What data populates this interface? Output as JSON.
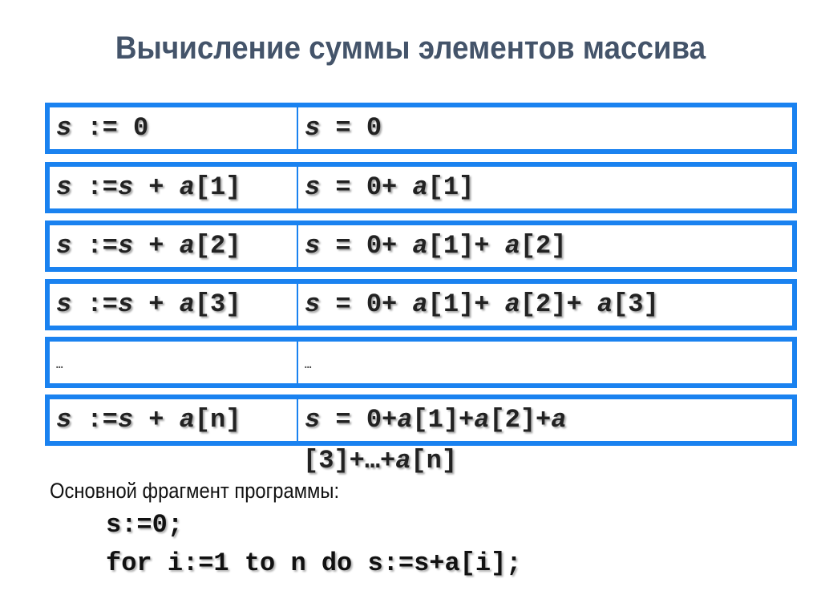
{
  "title": "Вычисление суммы элементов массива",
  "rows": [
    {
      "left": "s := 0",
      "right": "s = 0"
    },
    {
      "left": "s :=s + a[1]",
      "right": "s = 0+ a[1]"
    },
    {
      "left": "s :=s + a[2]",
      "right": "s = 0+ a[1]+ a[2]"
    },
    {
      "left": "s :=s + a[3]",
      "right": "s = 0+ a[1]+ a[2]+ a[3]"
    },
    {
      "left": "…",
      "right": "…"
    },
    {
      "left": "s :=s + a[n]",
      "right": "s = 0+a[1]+a[2]+a"
    }
  ],
  "last_row_continuation": "[3]+…+a[n]",
  "caption": "Основной фрагмент программы:",
  "code": [
    "s:=0;",
    "for i:=1 to n do s:=s+a[i];"
  ],
  "colors": {
    "border": "#1a82f0",
    "title": "#44546a"
  }
}
